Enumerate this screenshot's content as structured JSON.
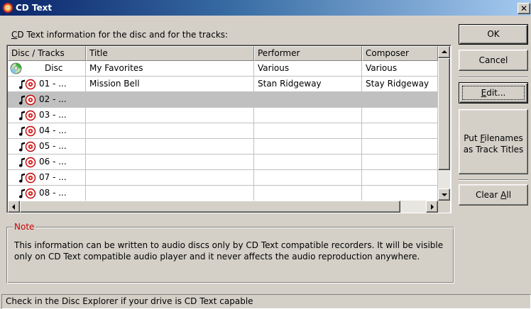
{
  "window": {
    "title": "CD Text",
    "close_glyph": "✕"
  },
  "grid_label": {
    "key": "C",
    "rest": "D Text information for the disc and for the tracks:"
  },
  "grid": {
    "columns": [
      "Disc / Tracks",
      "Title",
      "Performer",
      "Composer"
    ],
    "rows": [
      {
        "type": "disc",
        "number": "Disc",
        "title": "My Favorites",
        "performer": "Various",
        "composer": "Various"
      },
      {
        "type": "track",
        "number": "01 - ...",
        "title": "Mission Bell",
        "performer": "Stan Ridgeway",
        "composer": "Stay Ridgeway"
      },
      {
        "type": "track",
        "number": "02 - ...",
        "title": "",
        "performer": "",
        "composer": "",
        "selected": true
      },
      {
        "type": "track",
        "number": "03 - ...",
        "title": "",
        "performer": "",
        "composer": ""
      },
      {
        "type": "track",
        "number": "04 - ...",
        "title": "",
        "performer": "",
        "composer": ""
      },
      {
        "type": "track",
        "number": "05 - ...",
        "title": "",
        "performer": "",
        "composer": ""
      },
      {
        "type": "track",
        "number": "06 - ...",
        "title": "",
        "performer": "",
        "composer": ""
      },
      {
        "type": "track",
        "number": "07 - ...",
        "title": "",
        "performer": "",
        "composer": ""
      },
      {
        "type": "track",
        "number": "08 - ...",
        "title": "",
        "performer": "",
        "composer": ""
      }
    ]
  },
  "buttons": {
    "ok": "OK",
    "cancel": "Cancel",
    "edit": {
      "key": "E",
      "rest": "dit..."
    },
    "filenames": {
      "line1_before": "Put ",
      "line1_key": "F",
      "line1_after": "ilenames",
      "line2": "as Track Titles"
    },
    "clear_all": {
      "before": "Clear ",
      "key": "A",
      "after": "ll"
    }
  },
  "note": {
    "caption": "Note",
    "text": "This information can be written to audio discs only by CD Text compatible recorders. It will be visible only on CD Text compatible audio player and it never affects the audio reproduction anywhere."
  },
  "status": "Check in the Disc Explorer if your drive is CD Text capable",
  "colors": {
    "note_caption": "#cc0000",
    "titlebar_start": "#0a246a",
    "titlebar_end": "#a6caf0",
    "selected_row": "#c0c0c0"
  },
  "icons": {
    "app": "cd-text-app-icon",
    "disc": "cd-disc-icon",
    "track": "music-note-cd-icon"
  }
}
